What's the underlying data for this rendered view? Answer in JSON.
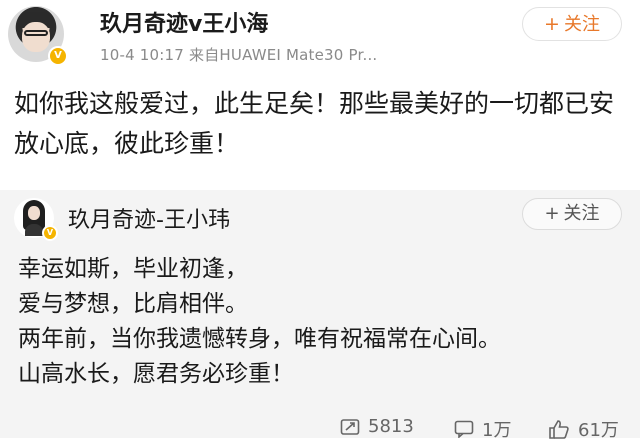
{
  "post": {
    "author": "玖月奇迹v王小海",
    "verified_badge": "V",
    "meta": "10-4 10:17  来自HUAWEI Mate30 Pr...",
    "follow_label": "关注",
    "text": "如你我这般爱过，此生足矣！那些最美好的一切都已安放心底，彼此珍重！"
  },
  "repost": {
    "author": "玖月奇迹-王小玮",
    "verified_badge": "V",
    "follow_label": "关注",
    "lines": [
      "幸运如斯，毕业初逢，",
      "爱与梦想，比肩相伴。",
      "两年前，当你我遗憾转身，唯有祝福常在心间。",
      "山高水长，愿君务必珍重！"
    ]
  },
  "actions": {
    "reposts": "5813",
    "comments": "1万",
    "likes": "61万"
  },
  "colors": {
    "accent": "#e8782a",
    "badge": "#f5b400",
    "card_bg": "#f4f4f4",
    "meta_text": "#8a8a8a"
  },
  "icons": [
    "repost-icon",
    "comment-icon",
    "like-icon",
    "verified-icon",
    "plus-icon"
  ]
}
